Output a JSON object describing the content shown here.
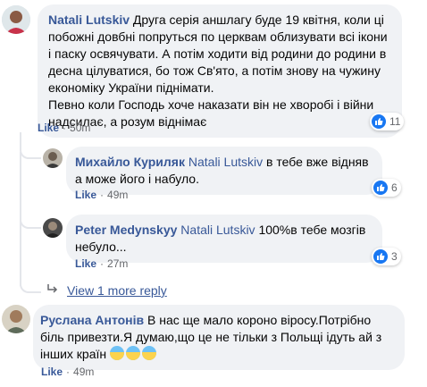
{
  "comments": [
    {
      "author": "Natali Lutskiv",
      "text": "Друга серія аншлагу буде 19 квітня, коли ці побожні довбні попруться по церквам облизувати всі ікони і паску освячувати. А потім ходити від родини до родини в десна цілуватися, бо тож Св'ято, а потім знову на чужину економіку України піднімати.",
      "text2": "Певно коли Господь хоче наказати він не хворобі і війни надсилає, а розум віднімає",
      "like_label": "Like",
      "time": "50m",
      "reactions": "11"
    },
    {
      "author": "Михайло Куриляк",
      "mention": "Natali Lutskiv",
      "text": " в тебе вже відняв а може його і набуло.",
      "like_label": "Like",
      "time": "49m",
      "reactions": "6"
    },
    {
      "author": "Peter Medynskyy",
      "mention": "Natali Lutskiv",
      "text": " 100%в тебе мозгів небуло...",
      "like_label": "Like",
      "time": "27m",
      "reactions": "3"
    },
    {
      "author": "Руслана Антонів",
      "text": " В нас ще мало короно віросу.Потрібно біль привезти.Я думаю,що це не тільки з Польщі ідуть ай з інших країн",
      "like_label": "Like",
      "time": "49m"
    }
  ],
  "view_more": "View 1 more reply",
  "colors": {
    "link": "#385898",
    "bubble": "#f0f2f5",
    "like_blue": "#1877f2"
  }
}
